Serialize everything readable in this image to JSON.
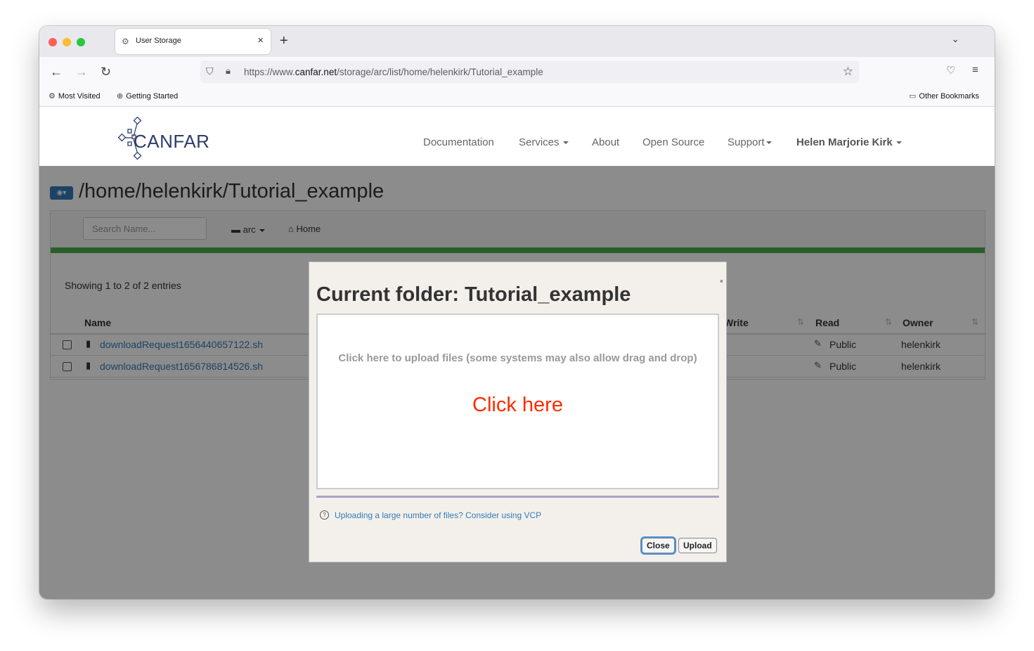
{
  "browser": {
    "tab_title": "User Storage",
    "url_prefix": "https://www.",
    "url_domain": "canfar.net",
    "url_path": "/storage/arc/list/home/helenkirk/Tutorial_example",
    "bookmarks": [
      "Most Visited",
      "Getting Started"
    ],
    "other_bookmarks": "Other Bookmarks"
  },
  "site": {
    "logo": "CANFAR",
    "nav": {
      "documentation": "Documentation",
      "services": "Services",
      "about": "About",
      "open_source": "Open Source",
      "support": "Support",
      "user": "Helen Marjorie Kirk"
    }
  },
  "storage": {
    "path": "/home/helenkirk/Tutorial_example",
    "search_placeholder": "Search Name...",
    "arc_label": "arc",
    "home_label": "Home",
    "showing": "Showing 1 to 2 of 2 entries",
    "columns": {
      "name": "Name",
      "write": "Write",
      "read": "Read",
      "owner": "Owner"
    },
    "rows": [
      {
        "name": "downloadRequest1656440657122.sh",
        "read": "Public",
        "owner": "helenkirk"
      },
      {
        "name": "downloadRequest1656786814526.sh",
        "read": "Public",
        "owner": "helenkirk"
      }
    ]
  },
  "modal": {
    "close_x": "×",
    "title": "Current folder: Tutorial_example",
    "dropzone_message": "Click here to upload files (some systems may also allow drag and drop)",
    "dropzone_click": "Click here",
    "help_link": "Uploading a large number of files? Consider using VCP",
    "close_button": "Close",
    "upload_button": "Upload"
  }
}
